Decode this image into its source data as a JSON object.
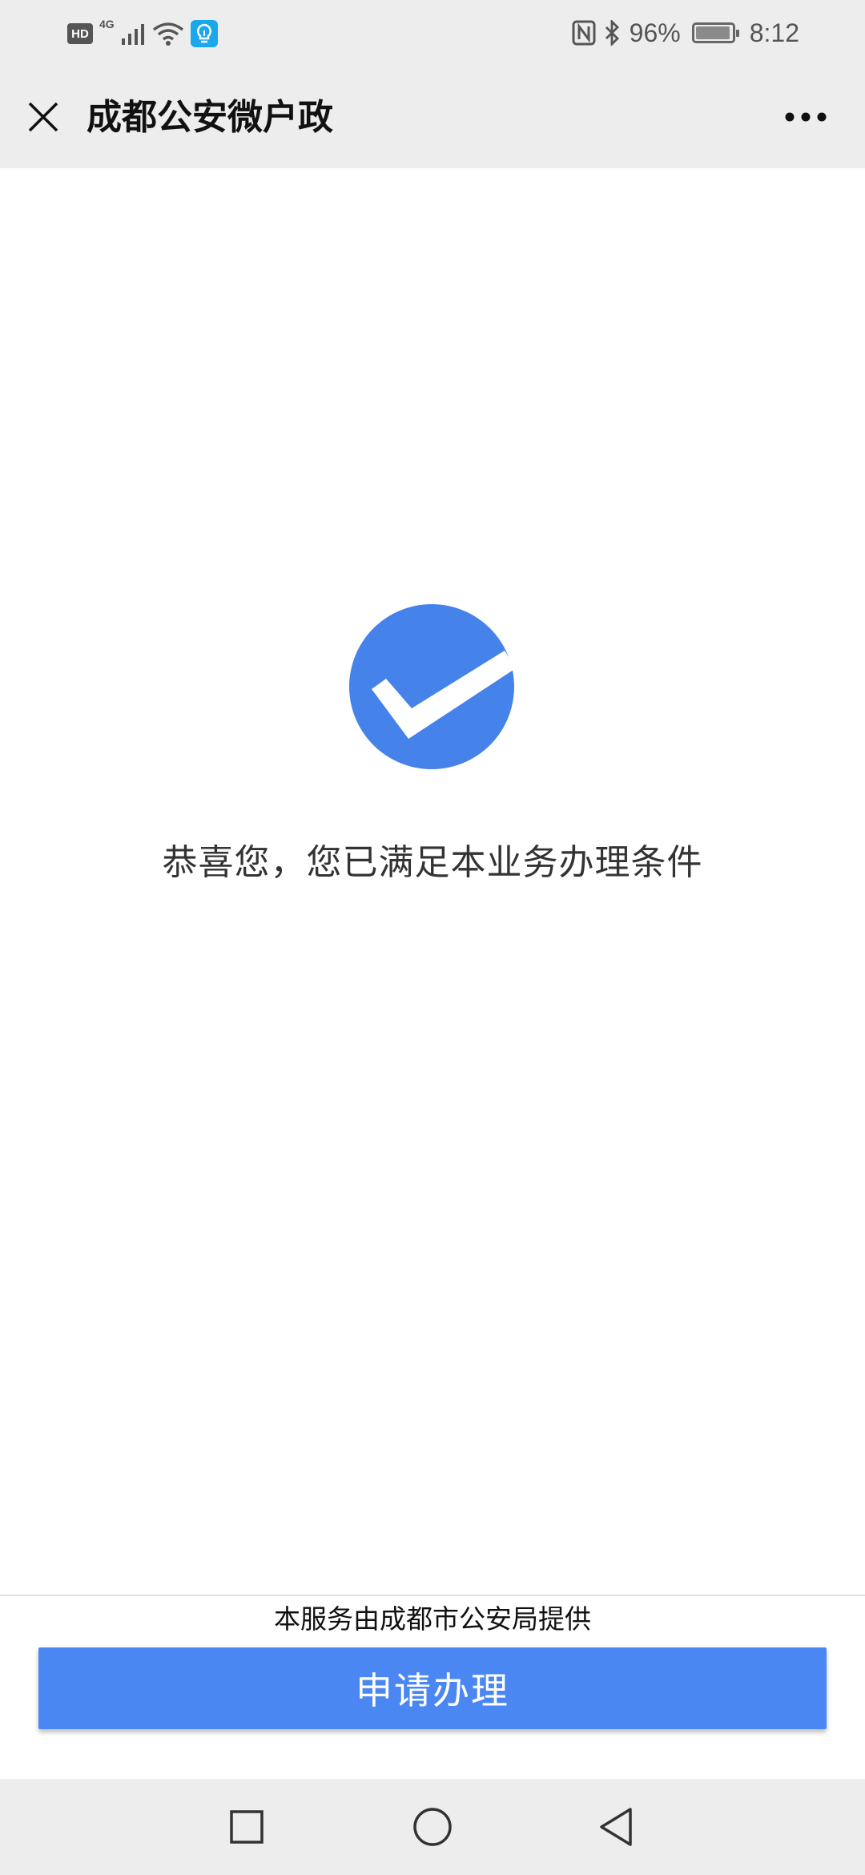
{
  "status_bar": {
    "hd_badge": "HD",
    "network": "4G",
    "nfc_icon": "nfc-icon",
    "bluetooth_icon": "bluetooth-icon",
    "battery_percent": "96%",
    "battery_level": 0.96,
    "time": "8:12"
  },
  "header": {
    "title": "成都公安微户政",
    "close_icon": "close-icon",
    "more_icon": "more-dots-icon"
  },
  "main": {
    "success_message": "恭喜您，您已满足本业务办理条件",
    "success_icon": "checkmark-circle-icon",
    "accent_color": "#4582ea"
  },
  "footer": {
    "provider_text": "本服务由成都市公安局提供",
    "apply_button_label": "申请办理",
    "button_color": "#4a87f2"
  },
  "nav_bar": {
    "recent_icon": "square-recents-icon",
    "home_icon": "circle-home-icon",
    "back_icon": "triangle-back-icon"
  }
}
